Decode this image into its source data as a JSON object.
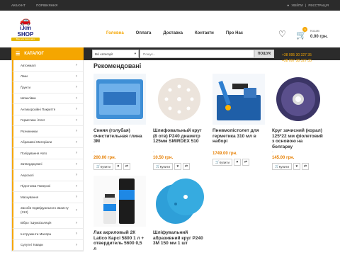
{
  "topbar": {
    "account": "АККАУНТ",
    "compare": "ПОРІВНЯННЯ",
    "login": "УВІЙТИ",
    "sep": "|",
    "register": "РЕЄСТРАЦІЯ"
  },
  "logo": {
    "name": "i.km SHOP",
    "tagline": "Все для твого авто"
  },
  "nav": [
    "Головна",
    "Оплата",
    "Доставка",
    "Контакти",
    "Про Нас"
  ],
  "cart": {
    "count": "0",
    "title": "Кошик",
    "total": "0.00 грн."
  },
  "catalog_label": "КАТАЛОГ",
  "search": {
    "category": "Всі категорії",
    "placeholder": "Пошук...",
    "button": "ПОШУК"
  },
  "phones": [
    "+38 095 30 327 35",
    "+38 097 38 327 35"
  ],
  "categories": [
    "Автоемалі",
    "Лаки",
    "Ґрунти",
    "Шпаклівки",
    "Антикорозійні Покриття",
    "Герметики і Клеї",
    "Розчинники",
    "Абразивні Матеріали",
    "Полірування Авто",
    "Затверджувачі",
    "Аерозолі",
    "Підготовка Поверхні",
    "Маскування",
    "Засоби Індивідуального Захисту (313)",
    "Вібро і Шумоізоляція",
    "Інструменти Маляра",
    "Супутні Товари"
  ],
  "section_title": "Рекомендовані",
  "products": [
    {
      "name": "Синяя (голубая) очистительная глина 3М",
      "price": "200.00 грн.",
      "buy": "Купити"
    },
    {
      "name": "Шлифовальный круг (8 отв) P240 диаметр 125мм SMIRDEX 510",
      "price": "10.50 грн.",
      "buy": "Купити"
    },
    {
      "name": "Пневмопістолет для герметика 310 мл в наборі",
      "price": "1749.00 грн.",
      "buy": "Купити"
    },
    {
      "name": "Круг зачисний (корал) 125*22 мм фіолетовий з основою на болгарку",
      "price": "145.00 грн.",
      "buy": "Купити"
    },
    {
      "name": "Лак акриловый 2К Latico Карсі 5800 1 л + отвердитель 5600 0,5 л",
      "price": "",
      "buy": ""
    },
    {
      "name": "Шліфувальний абразивний круг P240 3М 150 мм 1 шт",
      "price": "",
      "buy": ""
    }
  ],
  "dash": "-",
  "colors": {
    "accent": "#f5a600",
    "dark": "#2b2b2b",
    "price": "#e67e00"
  }
}
